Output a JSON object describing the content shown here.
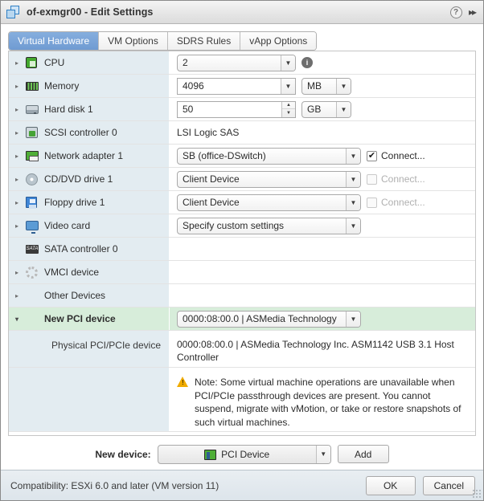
{
  "window": {
    "title": "of-exmgr00 - Edit Settings",
    "vm_icon": "virtual-machine-icon",
    "help_icon": "?",
    "expand_icon": "▸▸"
  },
  "tabs": [
    {
      "label": "Virtual Hardware",
      "active": true
    },
    {
      "label": "VM Options",
      "active": false
    },
    {
      "label": "SDRS Rules",
      "active": false
    },
    {
      "label": "vApp Options",
      "active": false
    }
  ],
  "rows": {
    "cpu": {
      "label": "CPU",
      "value": "2"
    },
    "memory": {
      "label": "Memory",
      "value": "4096",
      "unit": "MB"
    },
    "harddisk": {
      "label": "Hard disk 1",
      "value": "50",
      "unit": "GB"
    },
    "scsi": {
      "label": "SCSI controller 0",
      "value": "LSI Logic SAS"
    },
    "nic": {
      "label": "Network adapter 1",
      "value": "SB (office-DSwitch)",
      "connect": "Connect...",
      "checked": true
    },
    "cddvd": {
      "label": "CD/DVD drive 1",
      "value": "Client Device",
      "connect": "Connect...",
      "checked": false
    },
    "floppy": {
      "label": "Floppy drive 1",
      "value": "Client Device",
      "connect": "Connect...",
      "checked": false
    },
    "video": {
      "label": "Video card",
      "value": "Specify custom settings"
    },
    "sata": {
      "label": "SATA controller 0",
      "value": ""
    },
    "vmci": {
      "label": "VMCI device",
      "value": ""
    },
    "other": {
      "label": "Other Devices",
      "value": ""
    },
    "newpci": {
      "label": "New PCI device",
      "value": "0000:08:00.0 | ASMedia Technology"
    }
  },
  "pci_detail": {
    "label": "Physical PCI/PCIe device",
    "value": "0000:08:00.0 | ASMedia Technology Inc. ASM1142 USB 3.1 Host Controller",
    "note": "Note: Some virtual machine operations are unavailable when PCI/PCIe passthrough devices are present. You cannot suspend, migrate with vMotion, or take or restore snapshots of such virtual machines.",
    "warning_icon": "warning-triangle-icon"
  },
  "newdevice": {
    "label": "New device:",
    "selected": "PCI Device",
    "add_label": "Add"
  },
  "footer": {
    "compatibility": "Compatibility: ESXi 6.0 and later (VM version 11)",
    "ok_label": "OK",
    "cancel_label": "Cancel"
  },
  "colors": {
    "tab_active": "#6f9bd2",
    "row_label_bg": "#e3ecf1",
    "row_selected_bg": "#d7edda",
    "warning": "#f0ab00",
    "footer_bg": "#dde5eb"
  },
  "glyphs": {
    "collapsed": "▸",
    "expanded": "▾",
    "down": "▼",
    "up": "▲",
    "check": "✔",
    "sata_text": "SATA"
  }
}
